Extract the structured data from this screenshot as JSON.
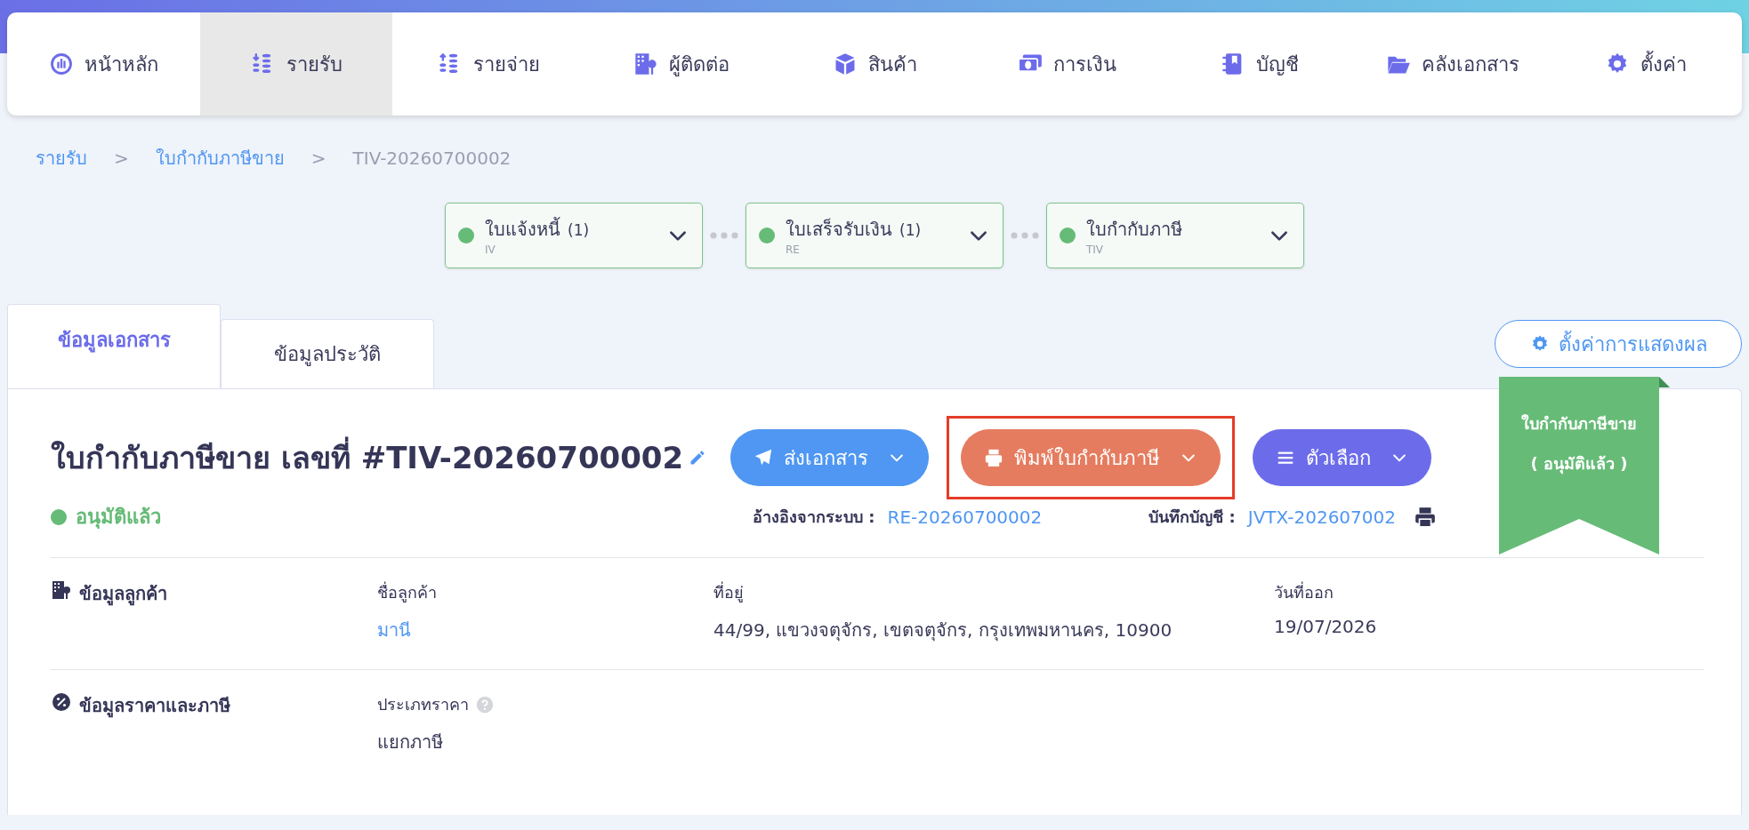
{
  "nav": [
    {
      "label": "หน้าหลัก",
      "selected": false
    },
    {
      "label": "รายรับ",
      "selected": true
    },
    {
      "label": "รายจ่าย",
      "selected": false
    },
    {
      "label": "ผู้ติดต่อ",
      "selected": false
    },
    {
      "label": "สินค้า",
      "selected": false
    },
    {
      "label": "การเงิน",
      "selected": false
    },
    {
      "label": "บัญชี",
      "selected": false
    },
    {
      "label": "คลังเอกสาร",
      "selected": false
    },
    {
      "label": "ตั้งค่า",
      "selected": false
    }
  ],
  "breadcrumb": [
    {
      "label": "รายรับ",
      "kind": "link"
    },
    {
      "label": ">",
      "kind": "separator"
    },
    {
      "label": "ใบกำกับภาษีขาย",
      "kind": "link"
    },
    {
      "label": ">",
      "kind": "separator"
    },
    {
      "label": "TIV-20260700002",
      "kind": "current"
    }
  ],
  "steps": [
    {
      "title": "ใบแจ้งหนี้",
      "count": "(1)",
      "code": "IV",
      "done": true
    },
    {
      "title": "ใบเสร็จรับเงิน",
      "count": "(1)",
      "code": "RE",
      "done": true
    },
    {
      "title": "ใบกำกับภาษี",
      "code": "TIV",
      "done": true
    }
  ],
  "tabs": [
    {
      "label": "ข้อมูลเอกสาร",
      "selected": true
    },
    {
      "label": "ข้อมูลประวัติ",
      "selected": false
    }
  ],
  "display_settings_button": {
    "label": "ตั้งค่าการแสดงผล"
  },
  "document": {
    "title": "ใบกำกับภาษีขาย เลขที่ #TIV-20260700002",
    "status": "อนุมัติแล้ว",
    "actions": [
      {
        "label": "ส่งเอกสาร",
        "kind": "send",
        "color": "#4f97f2",
        "highlighted": false
      },
      {
        "label": "พิมพ์ใบกำกับภาษี",
        "kind": "print",
        "color": "#e57c5f",
        "highlighted": true
      },
      {
        "label": "ตัวเลือก",
        "kind": "options",
        "color": "#6c6ceb",
        "highlighted": false
      }
    ],
    "references": [
      {
        "label": "อ้างอิงจากระบบ :",
        "value": "RE-20260700002",
        "printable": false
      },
      {
        "label": "บันทึกบัญชี :",
        "value": "JVTX-202607002",
        "printable": true
      }
    ],
    "ribbon": {
      "lines": [
        "ใบกำกับภาษีขาย",
        "( อนุมัติแล้ว )"
      ]
    },
    "sections": [
      {
        "title": "ข้อมูลลูกค้า",
        "fields": [
          {
            "label": "ชื่อลูกค้า",
            "value": "มานี",
            "link": true,
            "help": false
          },
          {
            "label": "ที่อยู่",
            "value": "44/99, แขวงจตุจักร, เขตจตุจักร, กรุงเทพมหานคร, 10900",
            "link": false,
            "help": false
          },
          {
            "label": "วันที่ออก",
            "value": "19/07/2026",
            "link": false,
            "help": false
          }
        ]
      },
      {
        "title": "ข้อมูลราคาและภาษี",
        "fields": [
          {
            "label": "ประเภทราคา",
            "value": "แยกภาษี",
            "link": false,
            "help": true
          }
        ]
      }
    ]
  }
}
